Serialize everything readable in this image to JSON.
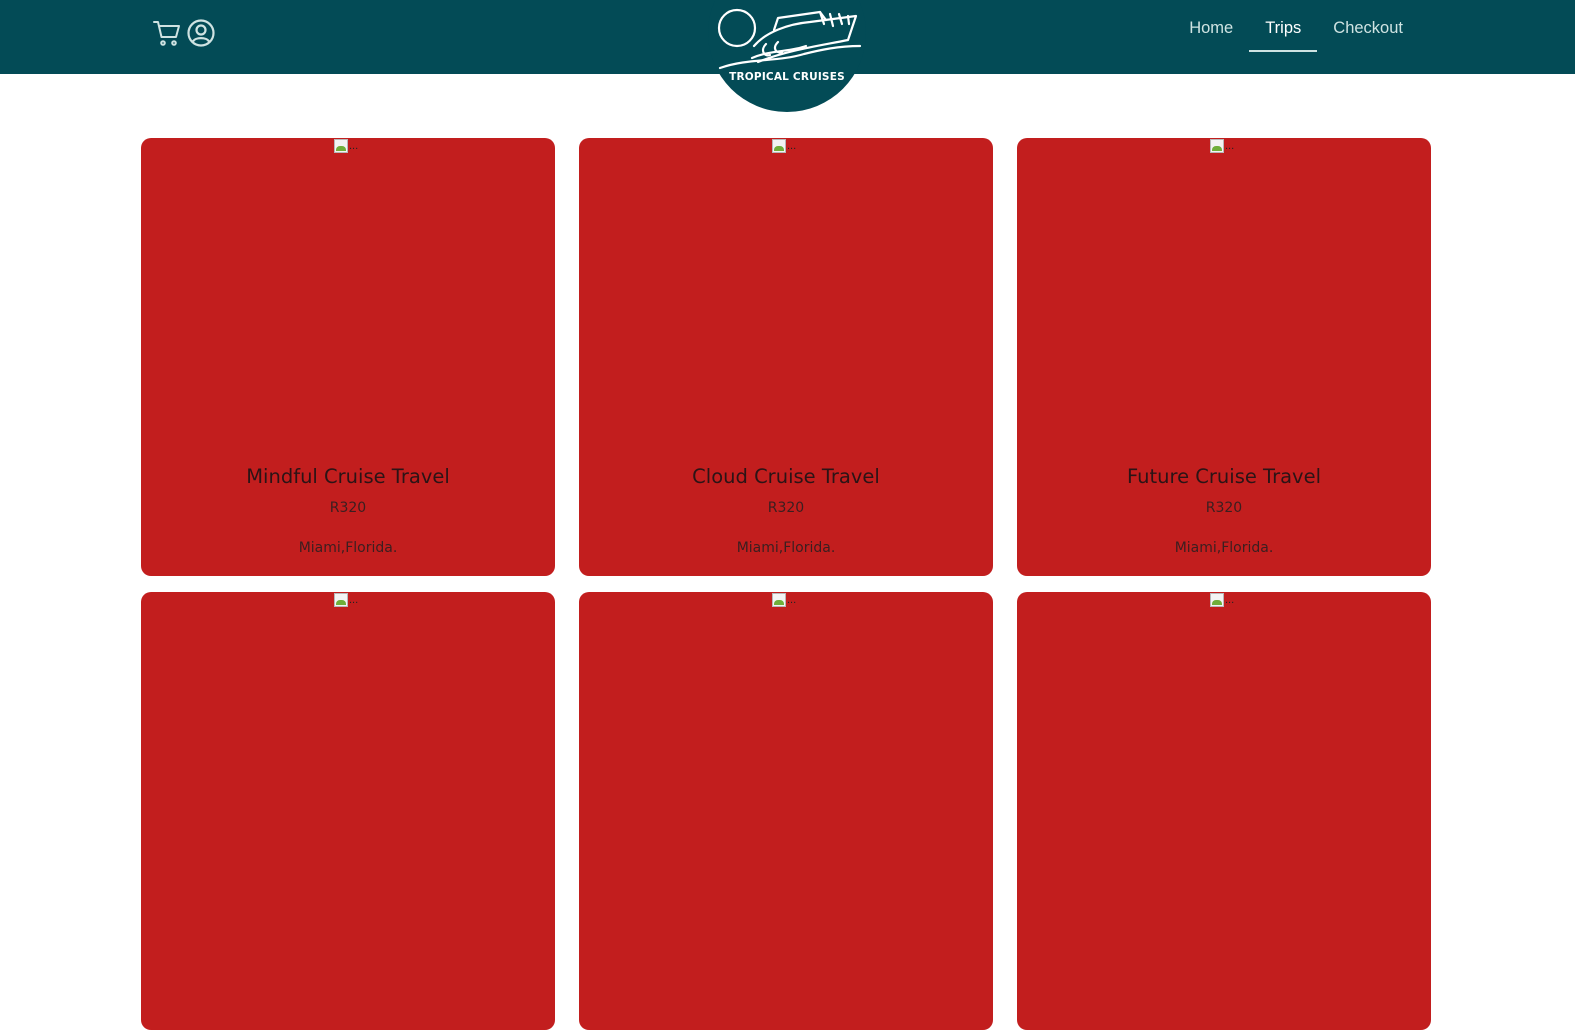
{
  "brand": {
    "logo_text": "TROPICAL CRUISES"
  },
  "colors": {
    "navbar": "#034b56",
    "card": "#c21e1e",
    "nav_link": "#cfe3e2",
    "active_link": "#ffffff"
  },
  "header": {
    "icons": [
      "cart-icon",
      "user-icon"
    ],
    "nav": [
      {
        "label": "Home",
        "active": false
      },
      {
        "label": "Trips",
        "active": true
      },
      {
        "label": "Checkout",
        "active": false
      }
    ]
  },
  "trips": [
    {
      "title": "Mindful Cruise Travel",
      "price": "R320",
      "location": "Miami,Florida.",
      "img_alt": "..."
    },
    {
      "title": "Cloud Cruise Travel",
      "price": "R320",
      "location": "Miami,Florida.",
      "img_alt": "..."
    },
    {
      "title": "Future Cruise Travel",
      "price": "R320",
      "location": "Miami,Florida.",
      "img_alt": "..."
    },
    {
      "title": "",
      "price": "",
      "location": "",
      "img_alt": "..."
    },
    {
      "title": "",
      "price": "",
      "location": "",
      "img_alt": "..."
    },
    {
      "title": "",
      "price": "",
      "location": "",
      "img_alt": "..."
    }
  ]
}
